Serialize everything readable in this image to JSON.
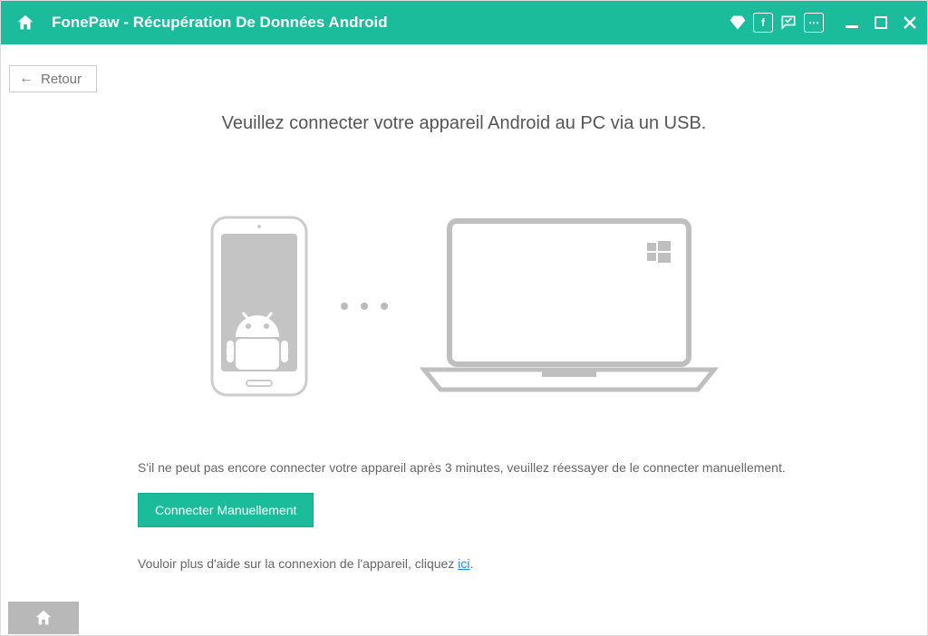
{
  "titlebar": {
    "title": "FonePaw - Récupération De Données Android"
  },
  "back": {
    "label": "Retour"
  },
  "main": {
    "instruction": "Veuillez connecter votre appareil Android au PC via un USB.",
    "retry_text": "S'il ne peut pas encore connecter votre appareil après 3 minutes, veuillez réessayer de le connecter manuellement.",
    "connect_button": "Connecter Manuellement",
    "help_prefix": "Vouloir plus d'aide sur la connexion de l'appareil, cliquez ",
    "help_link": "ici",
    "help_suffix": "."
  },
  "icons": {
    "facebook": "f",
    "more": "⋯"
  }
}
